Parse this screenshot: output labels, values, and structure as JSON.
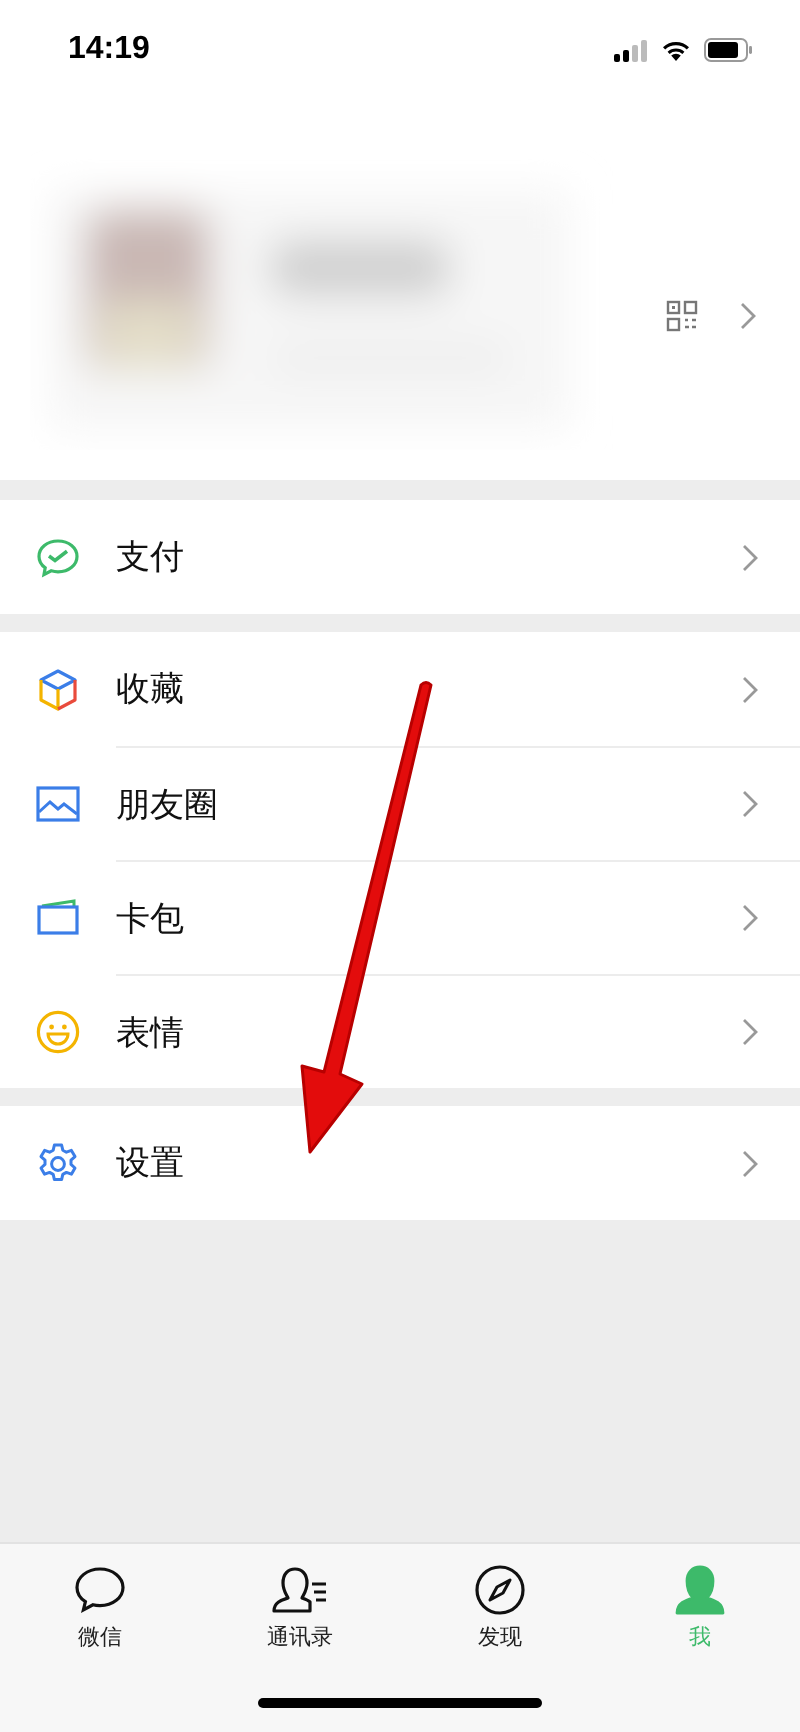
{
  "status_bar": {
    "time": "14:19"
  },
  "menu_groups": [
    [
      {
        "label": "支付"
      }
    ],
    [
      {
        "label": "收藏"
      },
      {
        "label": "朋友圈"
      },
      {
        "label": "卡包"
      },
      {
        "label": "表情"
      }
    ],
    [
      {
        "label": "设置"
      }
    ]
  ],
  "tabs": [
    {
      "label": "微信",
      "selected": false
    },
    {
      "label": "通讯录",
      "selected": false
    },
    {
      "label": "发现",
      "selected": false
    },
    {
      "label": "我",
      "selected": true
    }
  ]
}
